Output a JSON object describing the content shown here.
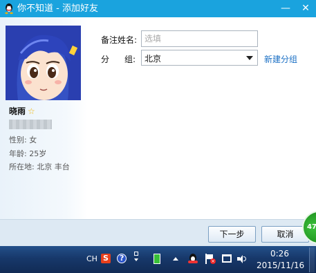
{
  "window": {
    "title": "你不知道 - 添加好友",
    "minimize_glyph": "—",
    "close_glyph": "✕"
  },
  "profile": {
    "nickname": "晓雨",
    "star_glyph": "☆",
    "gender": "性别: 女",
    "age": "年龄: 25岁",
    "location": "所在地: 北京  丰台"
  },
  "form": {
    "remark_label": "备注姓名:",
    "remark_placeholder": "选填",
    "group_label_1": "分",
    "group_label_2": "组:",
    "group_value": "北京",
    "new_group_link": "新建分组"
  },
  "footer": {
    "next_label": "下一步",
    "cancel_label": "取消",
    "badge": "47"
  },
  "taskbar": {
    "lang": "CH",
    "help_glyph": "?",
    "time": "0:26",
    "date": "2015/11/16"
  },
  "colors": {
    "titlebar": "#1aa3de",
    "link": "#1a6fc4",
    "taskbar": "#17386a"
  }
}
